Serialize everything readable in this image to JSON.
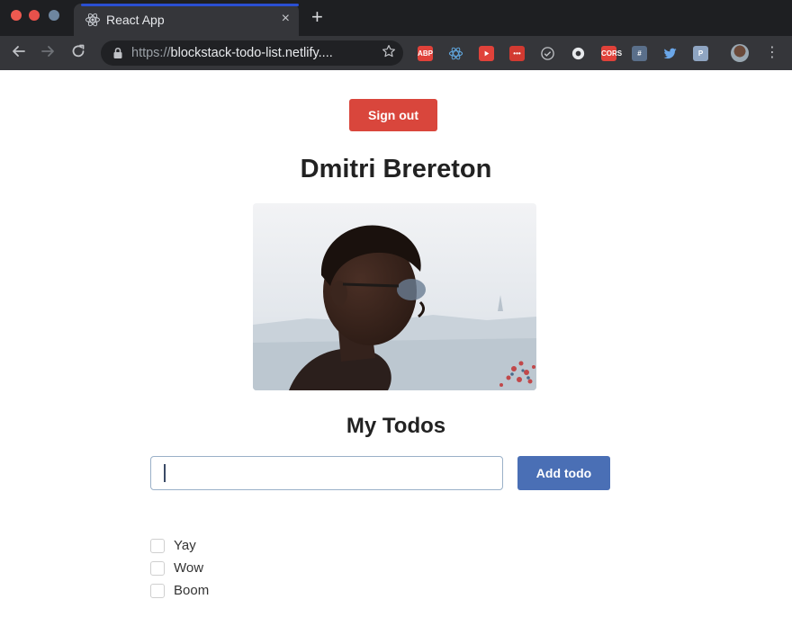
{
  "browser": {
    "tab_title": "React App",
    "tab_close": "×",
    "new_tab": "+",
    "url_scheme": "https://",
    "url_rest": "blockstack-todo-list.netlify....",
    "extensions": [
      {
        "name": "adblock-icon",
        "label": "ABP",
        "color": "#e0423a"
      },
      {
        "name": "react-devtools-icon",
        "label": "",
        "color": "#35363a"
      },
      {
        "name": "youtube-ext-icon",
        "label": "",
        "color": "#e0423a"
      },
      {
        "name": "ext-dots-icon",
        "label": "•••",
        "color": "#d23a31"
      },
      {
        "name": "check-ext-icon",
        "label": "",
        "color": "#35363a"
      },
      {
        "name": "blue-ext-icon",
        "label": "",
        "color": "#35363a"
      },
      {
        "name": "cors-ext-icon",
        "label": "CORS",
        "color": "#e0423a"
      },
      {
        "name": "hashtag-ext-icon",
        "label": "#",
        "color": "#5a6f8a"
      },
      {
        "name": "twitter-icon",
        "label": "",
        "color": "#35363a"
      },
      {
        "name": "p-ext-icon",
        "label": "P",
        "color": "#8fa5c2"
      }
    ]
  },
  "page": {
    "signout_label": "Sign out",
    "user_name": "Dmitri Brereton",
    "todos_title": "My Todos",
    "input_value": "",
    "add_label": "Add todo",
    "todos": [
      {
        "text": "Yay",
        "done": false
      },
      {
        "text": "Wow",
        "done": false
      },
      {
        "text": "Boom",
        "done": false
      }
    ]
  }
}
